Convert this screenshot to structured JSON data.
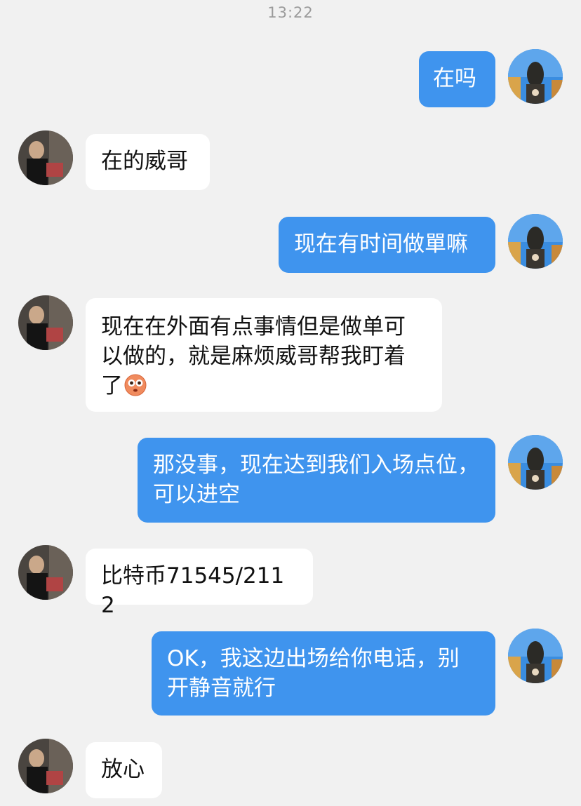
{
  "chat": {
    "timestamp": "13:22",
    "messages": [
      {
        "side": "right",
        "text": "在吗"
      },
      {
        "side": "left",
        "text": "在的威哥"
      },
      {
        "side": "right",
        "text": "现在有时间做單嘛"
      },
      {
        "side": "left",
        "text": "现在在外面有点事情但是做单可以做的，就是麻烦威哥帮我盯着了",
        "emoji": "flushed-face-emoji"
      },
      {
        "side": "right",
        "text": "那没事，现在达到我们入场点位，可以进空"
      },
      {
        "side": "left",
        "text": "比特币71545/2112"
      },
      {
        "side": "right",
        "text": "OK，我这边出场给你电话，别开静音就行"
      },
      {
        "side": "left",
        "text": "放心"
      }
    ]
  }
}
